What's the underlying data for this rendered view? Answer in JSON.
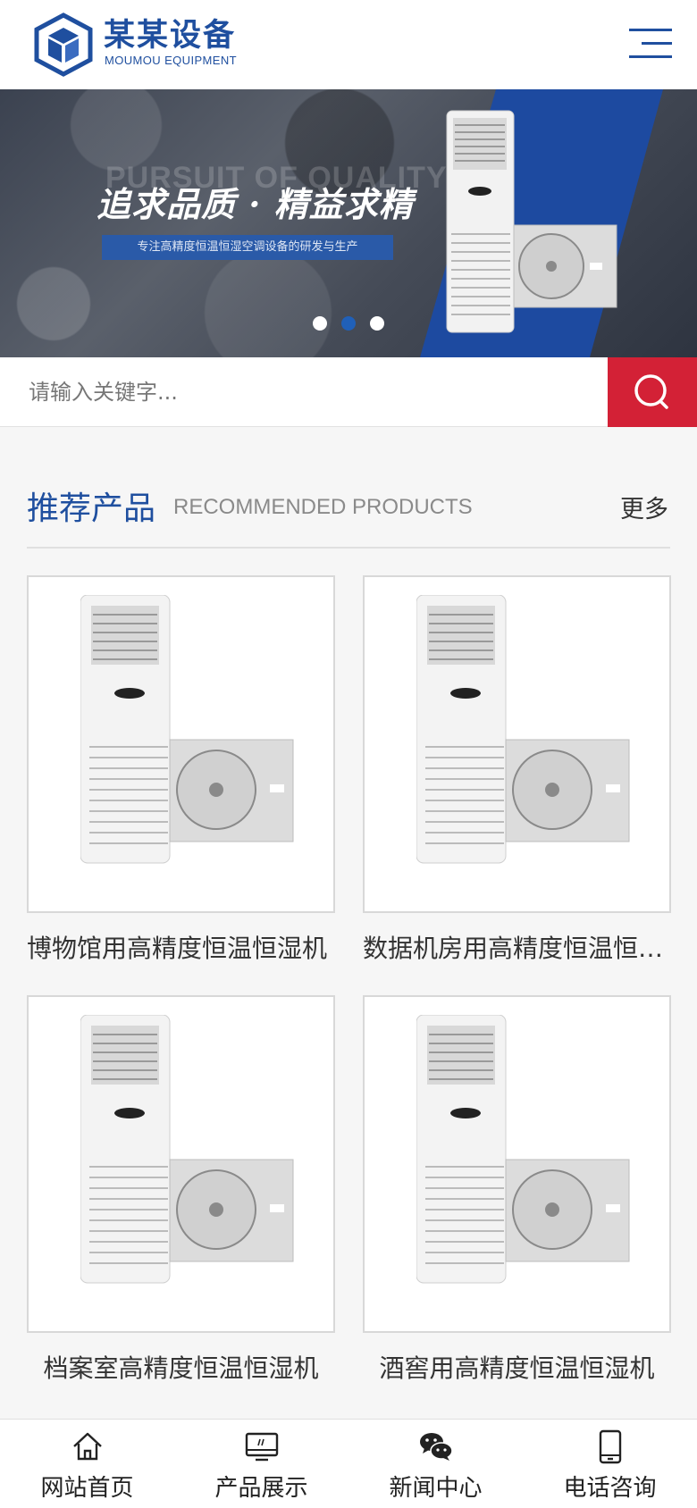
{
  "header": {
    "brand_name": "某某设备",
    "brand_sub": "MOUMOU EQUIPMENT",
    "menu_icon": "hamburger-icon",
    "brand_color": "#1f4f9f"
  },
  "banner": {
    "ghost_text": "PURSUIT OF QUALITY",
    "title": "追求品质 · 精益求精",
    "subtitle": "专注高精度恒温恒湿空调设备的研发与生产",
    "slide_count": 3,
    "active_slide": 2
  },
  "search": {
    "placeholder": "请输入关键字...",
    "button_icon": "search-icon",
    "button_color": "#d32136"
  },
  "section": {
    "title": "推荐产品",
    "title_en": "RECOMMENDED PRODUCTS",
    "more": "更多"
  },
  "products": [
    {
      "name": "博物馆用高精度恒温恒湿机"
    },
    {
      "name": "数据机房用高精度恒温恒湿机"
    },
    {
      "name": "档案室高精度恒温恒湿机"
    },
    {
      "name": "酒窖用高精度恒温恒湿机"
    }
  ],
  "bottom_nav": [
    {
      "label": "网站首页",
      "icon": "home-icon"
    },
    {
      "label": "产品展示",
      "icon": "monitor-icon"
    },
    {
      "label": "新闻中心",
      "icon": "wechat-icon"
    },
    {
      "label": "电话咨询",
      "icon": "phone-icon"
    }
  ]
}
